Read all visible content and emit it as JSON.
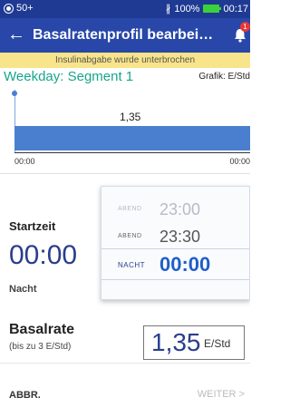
{
  "status_bar": {
    "left_text": "50+",
    "bluetooth_glyph": "∦",
    "battery_percent": "100%",
    "time": "00:17",
    "battery_color": "#3ad13a"
  },
  "app_bar": {
    "back_glyph": "←",
    "title": "Basalratenprofil bearbei…",
    "notification_count": "1",
    "color": "#2847a8"
  },
  "banner": {
    "text": "Insulinabgabe wurde unterbrochen",
    "color": "#f8e48a"
  },
  "segment": {
    "title": "Weekday: Segment 1",
    "grafik_label": "Grafik: E/Std"
  },
  "graph": {
    "value_label": "1,35",
    "start_tick": "00:00",
    "end_tick": "00:00",
    "bar_color": "#4a7fd0"
  },
  "start_time": {
    "label": "Startzeit",
    "value": "00:00",
    "period": "Nacht"
  },
  "basal_rate": {
    "label": "Basalrate",
    "hint": "(bis zu 3 E/Std)",
    "value": "1,35",
    "unit": "E/Std"
  },
  "time_picker": {
    "rows": [
      {
        "period": "ABEND",
        "time": "23:00"
      },
      {
        "period": "ABEND",
        "time": "23:30"
      },
      {
        "period": "NACHT",
        "time": "00:00"
      }
    ]
  },
  "footer": {
    "cancel_label": "ABBR.",
    "next_label": "WEITER",
    "next_glyph": ">"
  }
}
